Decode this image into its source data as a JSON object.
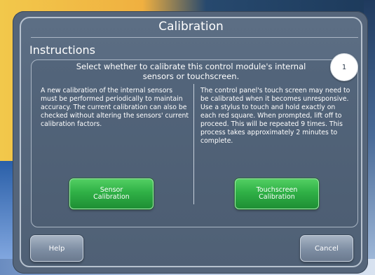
{
  "window": {
    "title": "Calibration"
  },
  "section": {
    "heading": "Instructions"
  },
  "prompt": {
    "text": "Select whether to calibrate this control module's internal sensors or touchscreen."
  },
  "step_badge": {
    "number": "1"
  },
  "options": {
    "sensor": {
      "description": "A new calibration of the internal sensors must be performed periodically to maintain accuracy. The current calibration can also be checked without altering the sensors' current calibration factors.",
      "button_label": "Sensor Calibration"
    },
    "touchscreen": {
      "description": "The control panel's touch screen may need to be calibrated when it becomes unresponsive. Use a stylus to touch and hold exactly on each red square. When prompted, lift off to proceed. This will be repeated 9 times. This process takes approximately 2 minutes to complete.",
      "button_label": "Touchscreen Calibration"
    }
  },
  "footer": {
    "help_label": "Help",
    "cancel_label": "Cancel"
  },
  "colors": {
    "screen_bg": "#55657a",
    "accent_green": "#2fb046",
    "text": "#ffffff"
  }
}
